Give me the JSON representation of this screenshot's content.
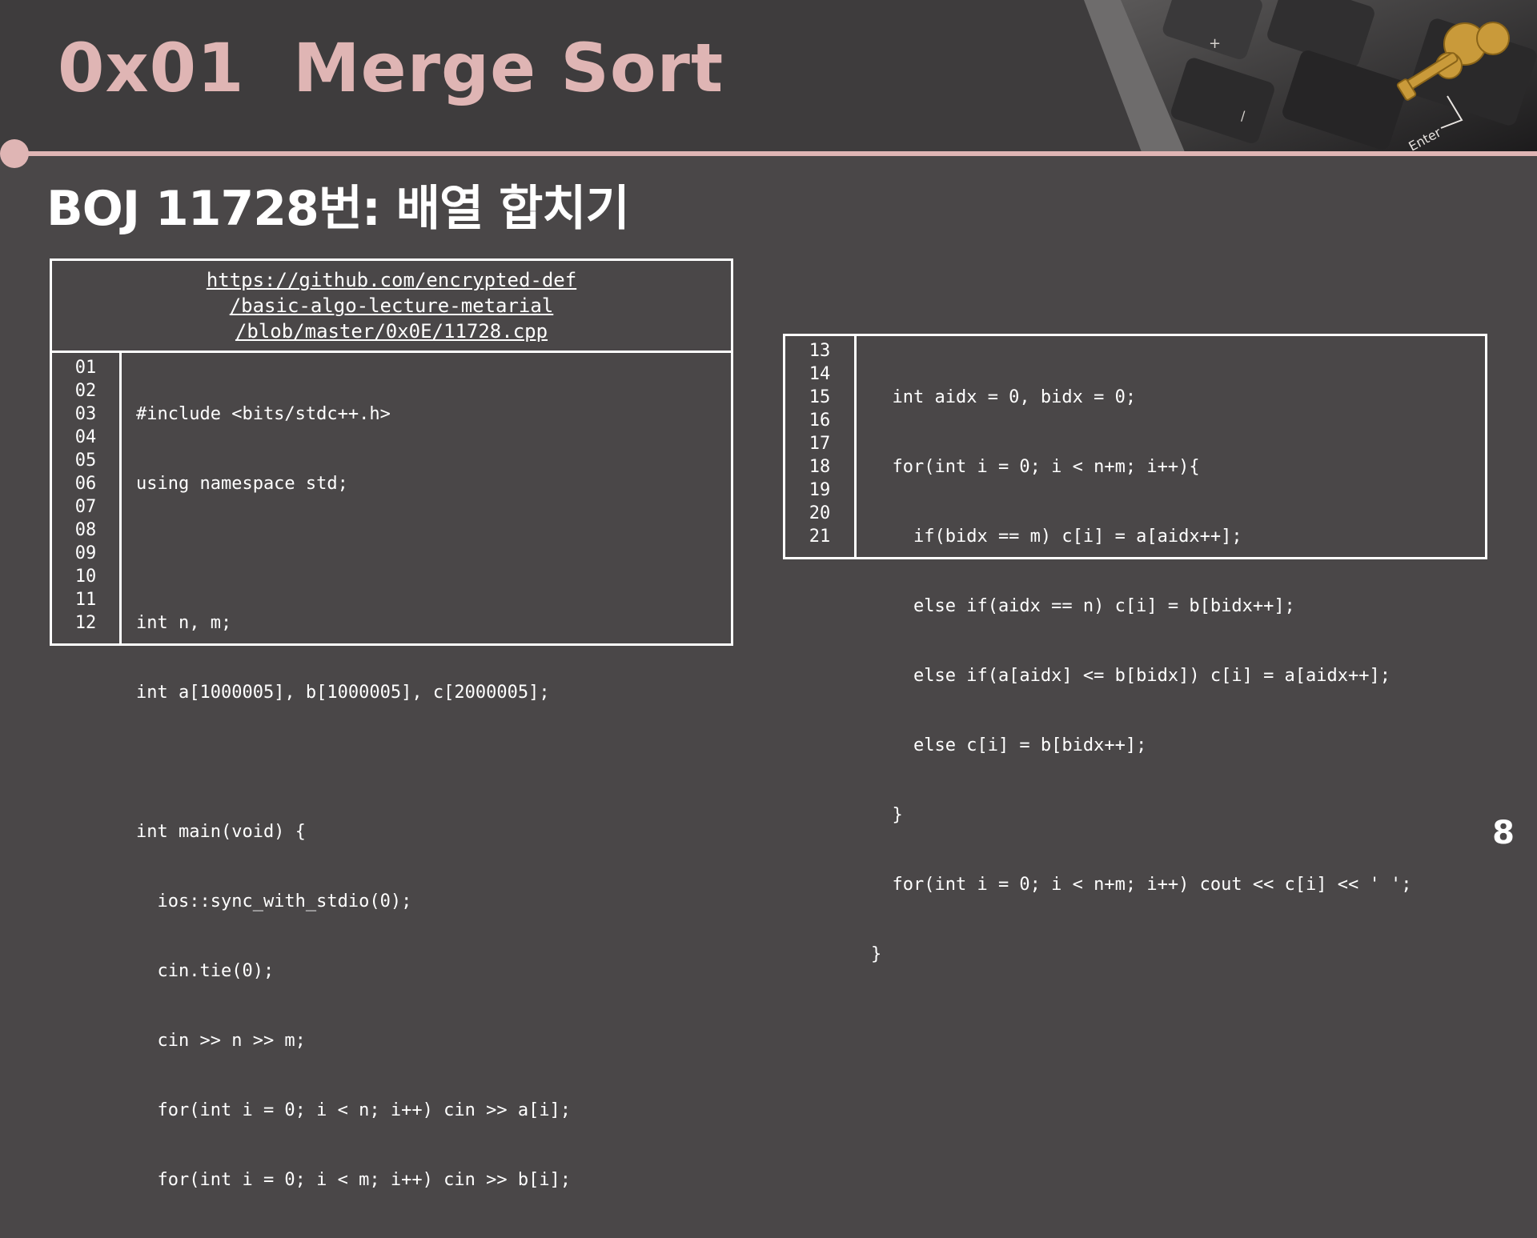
{
  "slide": {
    "title": "0x01  Merge Sort",
    "subtitle": "BOJ 11728번: 배열 합치기",
    "page_number": "8"
  },
  "colors": {
    "accent": "#dfb5b4",
    "background": "#4a4748",
    "header_background": "#3e3c3d"
  },
  "decoration": {
    "image": "keyboard-with-golden-key",
    "key_label": "Enter"
  },
  "link": {
    "lines": [
      "https://github.com/encrypted-def",
      "/basic-algo-lecture-metarial",
      "/blob/master/0x0E/11728.cpp"
    ]
  },
  "code_left": {
    "line_numbers": [
      "01",
      "02",
      "03",
      "04",
      "05",
      "06",
      "07",
      "08",
      "09",
      "10",
      "11",
      "12"
    ],
    "lines": [
      "#include <bits/stdc++.h>",
      "using namespace std;",
      "",
      "int n, m;",
      "int a[1000005], b[1000005], c[2000005];",
      "",
      "int main(void) {",
      "  ios::sync_with_stdio(0);",
      "  cin.tie(0);",
      "  cin >> n >> m;",
      "  for(int i = 0; i < n; i++) cin >> a[i];",
      "  for(int i = 0; i < m; i++) cin >> b[i];"
    ]
  },
  "code_right": {
    "line_numbers": [
      "13",
      "14",
      "15",
      "16",
      "17",
      "18",
      "19",
      "20",
      "21"
    ],
    "lines": [
      "  int aidx = 0, bidx = 0;",
      "  for(int i = 0; i < n+m; i++){",
      "    if(bidx == m) c[i] = a[aidx++];",
      "    else if(aidx == n) c[i] = b[bidx++];",
      "    else if(a[aidx] <= b[bidx]) c[i] = a[aidx++];",
      "    else c[i] = b[bidx++];",
      "  }",
      "  for(int i = 0; i < n+m; i++) cout << c[i] << ' ';",
      "}"
    ]
  }
}
